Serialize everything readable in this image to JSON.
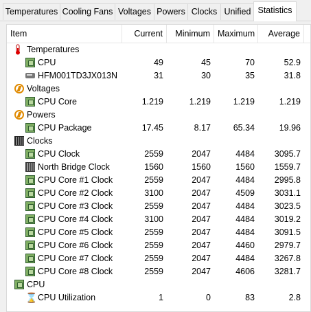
{
  "tabs": [
    {
      "label": "Temperatures"
    },
    {
      "label": "Cooling Fans"
    },
    {
      "label": "Voltages"
    },
    {
      "label": "Powers"
    },
    {
      "label": "Clocks"
    },
    {
      "label": "Unified"
    },
    {
      "label": "Statistics"
    }
  ],
  "active_tab": "Statistics",
  "columns": {
    "item": "Item",
    "current": "Current",
    "minimum": "Minimum",
    "maximum": "Maximum",
    "average": "Average"
  },
  "rows": [
    {
      "type": "group",
      "label": "Temperatures",
      "icon": "thermometer-icon"
    },
    {
      "type": "item",
      "label": "CPU",
      "icon": "chip-icon",
      "current": "49",
      "minimum": "45",
      "maximum": "70",
      "average": "52.9"
    },
    {
      "type": "item",
      "label": "HFM001TD3JX013N",
      "icon": "drive-icon",
      "current": "31",
      "minimum": "30",
      "maximum": "35",
      "average": "31.8"
    },
    {
      "type": "group",
      "label": "Voltages",
      "icon": "lightning-icon"
    },
    {
      "type": "item",
      "label": "CPU Core",
      "icon": "chip-icon",
      "current": "1.219",
      "minimum": "1.219",
      "maximum": "1.219",
      "average": "1.219"
    },
    {
      "type": "group",
      "label": "Powers",
      "icon": "lightning-icon"
    },
    {
      "type": "item",
      "label": "CPU Package",
      "icon": "chip-icon",
      "current": "17.45",
      "minimum": "8.17",
      "maximum": "65.34",
      "average": "19.96"
    },
    {
      "type": "group",
      "label": "Clocks",
      "icon": "clock-chip-icon"
    },
    {
      "type": "item",
      "label": "CPU Clock",
      "icon": "chip-icon",
      "current": "2559",
      "minimum": "2047",
      "maximum": "4484",
      "average": "3095.7"
    },
    {
      "type": "item",
      "label": "North Bridge Clock",
      "icon": "northbridge-icon",
      "current": "1560",
      "minimum": "1560",
      "maximum": "1560",
      "average": "1559.7"
    },
    {
      "type": "item",
      "label": "CPU Core #1 Clock",
      "icon": "chip-icon",
      "current": "2559",
      "minimum": "2047",
      "maximum": "4484",
      "average": "2995.8"
    },
    {
      "type": "item",
      "label": "CPU Core #2 Clock",
      "icon": "chip-icon",
      "current": "3100",
      "minimum": "2047",
      "maximum": "4509",
      "average": "3031.1"
    },
    {
      "type": "item",
      "label": "CPU Core #3 Clock",
      "icon": "chip-icon",
      "current": "2559",
      "minimum": "2047",
      "maximum": "4484",
      "average": "3023.5"
    },
    {
      "type": "item",
      "label": "CPU Core #4 Clock",
      "icon": "chip-icon",
      "current": "3100",
      "minimum": "2047",
      "maximum": "4484",
      "average": "3019.2"
    },
    {
      "type": "item",
      "label": "CPU Core #5 Clock",
      "icon": "chip-icon",
      "current": "2559",
      "minimum": "2047",
      "maximum": "4484",
      "average": "3091.5"
    },
    {
      "type": "item",
      "label": "CPU Core #6 Clock",
      "icon": "chip-icon",
      "current": "2559",
      "minimum": "2047",
      "maximum": "4460",
      "average": "2979.7"
    },
    {
      "type": "item",
      "label": "CPU Core #7 Clock",
      "icon": "chip-icon",
      "current": "2559",
      "minimum": "2047",
      "maximum": "4484",
      "average": "3267.8"
    },
    {
      "type": "item",
      "label": "CPU Core #8 Clock",
      "icon": "chip-icon",
      "current": "2559",
      "minimum": "2047",
      "maximum": "4606",
      "average": "3281.7"
    },
    {
      "type": "group",
      "label": "CPU",
      "icon": "chip-icon"
    },
    {
      "type": "item",
      "label": "CPU Utilization",
      "icon": "hourglass-icon",
      "current": "1",
      "minimum": "0",
      "maximum": "83",
      "average": "2.8"
    }
  ]
}
